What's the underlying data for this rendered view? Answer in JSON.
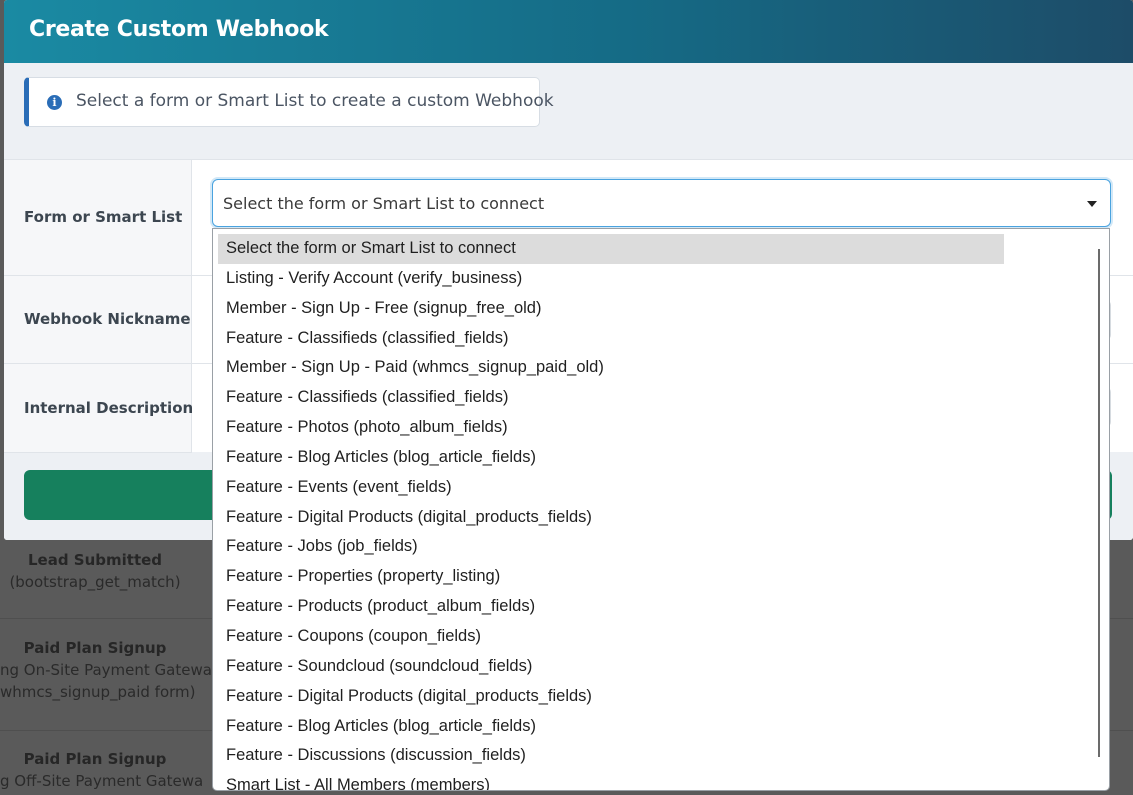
{
  "background_rows": [
    {
      "title": "Lead Submitted",
      "sub1": "(bootstrap_get_match)",
      "sub2": ""
    },
    {
      "title": "Paid Plan Signup",
      "sub1": "ng On-Site Payment Gatewa",
      "sub2": "whmcs_signup_paid form)"
    },
    {
      "title": "Paid Plan Signup",
      "sub1": "g Off-Site Payment Gatewa",
      "sub2": ""
    }
  ],
  "modal": {
    "title": "Create Custom Webhook",
    "info_text": "Select a form or Smart List to create a custom Webhook",
    "fields": {
      "form_label": "Form or Smart List",
      "nickname_label": "Webhook Nickname",
      "description_label": "Internal Description"
    },
    "select": {
      "value": "Select the form or Smart List to connect",
      "options": [
        "Select the form or Smart List to connect",
        "Listing - Verify Account (verify_business)",
        "Member - Sign Up - Free (signup_free_old)",
        "Feature - Classifieds (classified_fields)",
        "Member - Sign Up - Paid (whmcs_signup_paid_old)",
        "Feature - Classifieds (classified_fields)",
        "Feature - Photos (photo_album_fields)",
        "Feature - Blog Articles (blog_article_fields)",
        "Feature - Events (event_fields)",
        "Feature - Digital Products (digital_products_fields)",
        "Feature - Jobs (job_fields)",
        "Feature - Properties (property_listing)",
        "Feature - Products (product_album_fields)",
        "Feature - Coupons (coupon_fields)",
        "Feature - Soundcloud (soundcloud_fields)",
        "Feature - Digital Products (digital_products_fields)",
        "Feature - Blog Articles (blog_article_fields)",
        "Feature - Discussions (discussion_fields)",
        "Smart List - All Members (members)"
      ]
    }
  },
  "colors": {
    "header_start": "#1a8aa3",
    "header_end": "#1d4c68",
    "info_accent": "#2a6db7",
    "submit_green": "#16805d",
    "focus_border": "#4aa3df"
  },
  "icons": {
    "info": "info-circle-icon",
    "caret": "caret-down-icon"
  }
}
